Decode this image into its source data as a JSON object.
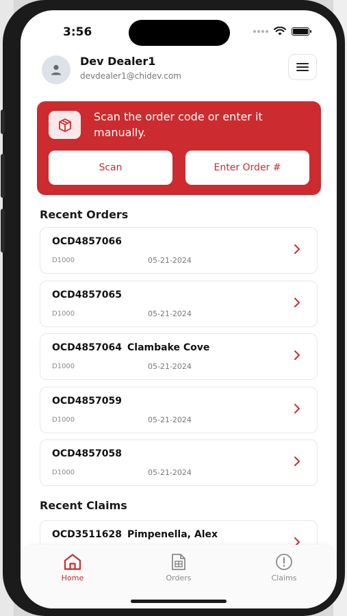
{
  "status": {
    "time": "3:56"
  },
  "user": {
    "name": "Dev Dealer1",
    "email": "devdealer1@chidev.com"
  },
  "banner": {
    "text": "Scan the order code or enter it manually.",
    "scan_label": "Scan",
    "enter_label": "Enter Order #"
  },
  "recent_orders": {
    "title": "Recent Orders",
    "items": [
      {
        "code": "OCD4857066",
        "name": "",
        "dealer": "D1000",
        "date": "05-21-2024"
      },
      {
        "code": "OCD4857065",
        "name": "",
        "dealer": "D1000",
        "date": "05-21-2024"
      },
      {
        "code": "OCD4857064",
        "name": "Clambake Cove",
        "dealer": "D1000",
        "date": "05-21-2024"
      },
      {
        "code": "OCD4857059",
        "name": "",
        "dealer": "D1000",
        "date": "05-21-2024"
      },
      {
        "code": "OCD4857058",
        "name": "",
        "dealer": "D1000",
        "date": "05-21-2024"
      }
    ]
  },
  "recent_claims": {
    "title": "Recent Claims",
    "items": [
      {
        "code": "OCD3511628",
        "name": "Pimpenella, Alex"
      }
    ]
  },
  "tabs": [
    {
      "label": "Home",
      "icon": "home-icon",
      "active": true
    },
    {
      "label": "Orders",
      "icon": "document-icon",
      "active": false
    },
    {
      "label": "Claims",
      "icon": "alert-circle-icon",
      "active": false
    }
  ],
  "colors": {
    "accent": "#cc2b2f",
    "inactive": "#8a8a8a"
  }
}
